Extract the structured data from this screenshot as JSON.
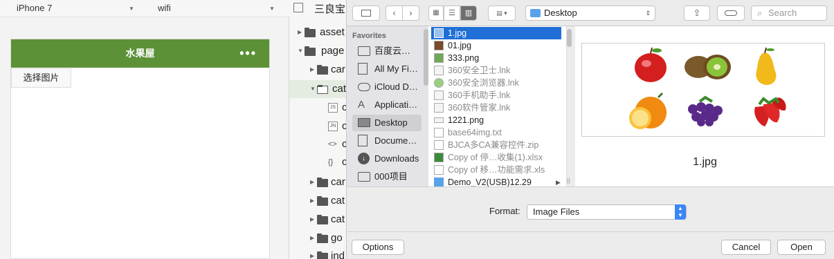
{
  "simulator": {
    "device": "iPhone 7",
    "network": "wifi",
    "nav_title": "水果屋",
    "nav_menu": "•••",
    "choose_button": "选择图片"
  },
  "tree": {
    "window_title": "三良宝",
    "rows": [
      "asset",
      "page",
      "car",
      "cat",
      "",
      "",
      "",
      "",
      "car",
      "cat",
      "cat",
      "go",
      "ind"
    ],
    "file_badges": [
      "JS",
      "JN",
      "<>",
      "{}"
    ]
  },
  "dialog": {
    "location": "Desktop",
    "search_placeholder": "Search",
    "favorites_header": "Favorites",
    "sidebar": [
      "百度云…",
      "All My Fi…",
      "iCloud D…",
      "Applicati…",
      "Desktop",
      "Docume…",
      "Downloads",
      "000项目"
    ],
    "files": [
      "1.jpg",
      "01.jpg",
      "333.png",
      "360安全卫士.lnk",
      "360安全浏览器.lnk",
      "360手机助手.lnk",
      "360软件管家.lnk",
      "1221.png",
      "base64img.txt",
      "BJCA多CA兼容控件.zip",
      "Copy of 停…收集(1).xlsx",
      "Copy of 移…功能需求.xls",
      "Demo_V2(USB)12.29"
    ],
    "preview_name": "1.jpg",
    "format_label": "Format:",
    "format_value": "Image Files",
    "options_label": "Options",
    "cancel_label": "Cancel",
    "open_label": "Open"
  },
  "colors": {
    "nav_green": "#5c9137",
    "selection_blue": "#1f6fd6"
  }
}
